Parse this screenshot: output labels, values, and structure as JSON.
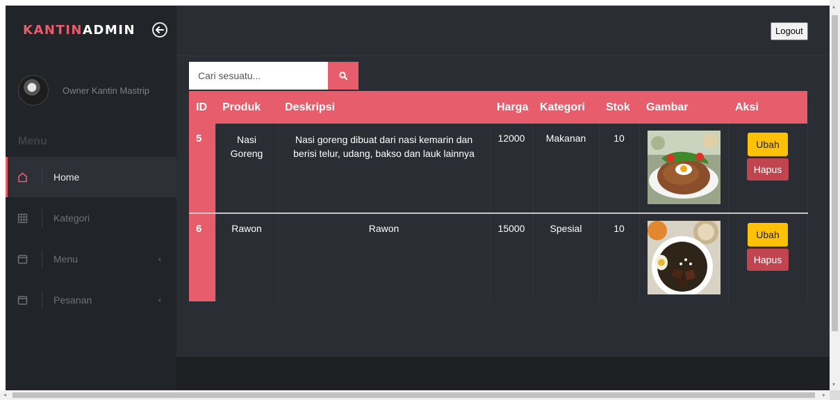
{
  "brand": {
    "part1": "KANTIN",
    "part2": "ADMIN",
    "accent_color": "#e85d6c"
  },
  "header": {
    "toggle_icon": "arrow-left-icon",
    "logout_label": "Logout"
  },
  "sidebar": {
    "profile_name": "Owner Kantin Mastrip",
    "menu_title": "Menu",
    "items": [
      {
        "label": "Home",
        "icon": "home-icon",
        "active": true
      },
      {
        "label": "Kategori",
        "icon": "grid-icon",
        "active": false
      },
      {
        "label": "Menu",
        "icon": "window-icon",
        "active": false,
        "caret": "‹"
      },
      {
        "label": "Pesanan",
        "icon": "window-icon",
        "active": false,
        "caret": "‹"
      }
    ]
  },
  "search": {
    "placeholder": "Cari sesuatu...",
    "icon": "search-icon"
  },
  "table": {
    "headers": [
      "ID",
      "Produk",
      "Deskripsi",
      "Harga",
      "Kategori",
      "Stok",
      "Gambar",
      "Aksi"
    ],
    "rows": [
      {
        "id": "5",
        "produk": "Nasi Goreng",
        "deskripsi": "Nasi goreng dibuat dari nasi kemarin dan berisi telur, udang, bakso dan lauk lainnya",
        "harga": "12000",
        "kategori": "Makanan",
        "stok": "10",
        "gambar": "nasi-goreng-photo"
      },
      {
        "id": "6",
        "produk": "Rawon",
        "deskripsi": "Rawon",
        "harga": "15000",
        "kategori": "Spesial",
        "stok": "10",
        "gambar": "rawon-photo"
      }
    ],
    "action_edit": "Ubah",
    "action_delete": "Hapus"
  },
  "scrollbar": {
    "left_arrow": "◂",
    "right_arrow": "▸",
    "up_arrow": "▴",
    "down_arrow": "▾"
  }
}
